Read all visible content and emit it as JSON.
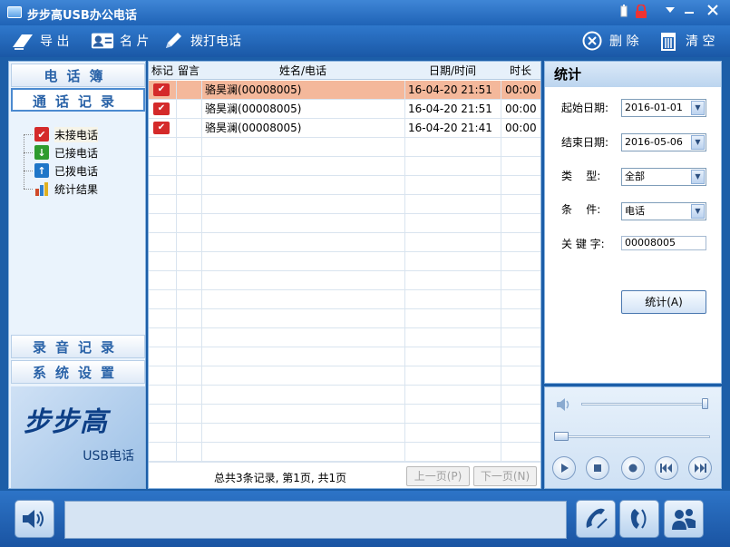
{
  "window": {
    "title": "步步高USB办公电话",
    "controls": [
      "battery-icon",
      "lock-icon",
      "minimize-icon",
      "close-icon"
    ]
  },
  "toolbar": {
    "export_label": "导 出",
    "card_label": "名 片",
    "dial_label": "拨打电话",
    "delete_label": "删 除",
    "clear_label": "清 空"
  },
  "nav": {
    "phonebook": "电话簿",
    "call_log": "通话记录",
    "tree": [
      {
        "label": "未接电话",
        "icon": "missed-call-icon",
        "color": "#d42a2a",
        "glyph": "✔"
      },
      {
        "label": "已接电话",
        "icon": "received-call-icon",
        "color": "#2e9b2e",
        "glyph": "↓"
      },
      {
        "label": "已拨电话",
        "icon": "dialed-call-icon",
        "color": "#1f76c8",
        "glyph": "↑"
      },
      {
        "label": "统计结果",
        "icon": "stats-chart-icon",
        "color": "#d04a2a",
        "glyph": "▮"
      }
    ],
    "recordings": "录音记录",
    "settings": "系统设置",
    "brand_logo": "步步高",
    "brand_sub": "USB电话"
  },
  "table": {
    "headers": {
      "mark": "标记",
      "message": "留言",
      "name_phone": "姓名/电话",
      "datetime": "日期/时间",
      "duration": "时长"
    },
    "rows": [
      {
        "name": "骆昊澜(00008005)",
        "datetime": "16-04-20 21:51",
        "duration": "00:00"
      },
      {
        "name": "骆昊澜(00008005)",
        "datetime": "16-04-20 21:51",
        "duration": "00:00"
      },
      {
        "name": "骆昊澜(00008005)",
        "datetime": "16-04-20 21:41",
        "duration": "00:00"
      }
    ],
    "pager_info": "总共3条记录, 第1页, 共1页",
    "prev_label": "上一页(P)",
    "next_label": "下一页(N)"
  },
  "stats": {
    "title": "统计",
    "start_label": "起始日期:",
    "start_value": "2016-01-01",
    "end_label": "结束日期:",
    "end_value": "2016-05-06",
    "type_label": "类    型:",
    "type_value": "全部",
    "cond_label": "条    件:",
    "cond_value": "电话",
    "keyword_label": "关 键 字:",
    "keyword_value": "00008005",
    "button_label": "统计(A)"
  },
  "player": {
    "volume_level": 1.0,
    "progress_level": 0.0
  },
  "colors": {
    "accent": "#1f63b6",
    "selected_row": "#f4b89b",
    "missed_flag": "#d42a2a"
  }
}
